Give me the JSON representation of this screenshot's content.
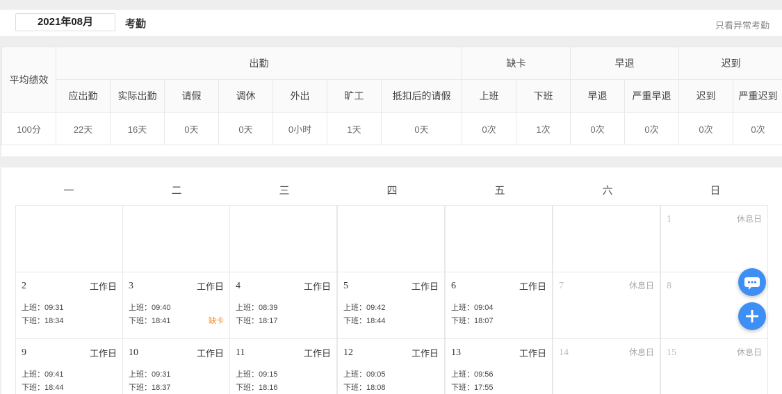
{
  "header": {
    "month": "2021年08月",
    "title": "考勤",
    "abnormal_link": "只看异常考勤"
  },
  "stats": {
    "avg_label": "平均绩效",
    "groups": {
      "attendance": "出勤",
      "missing": "缺卡",
      "early": "早退",
      "late": "迟到"
    },
    "columns": [
      "应出勤",
      "实际出勤",
      "请假",
      "调休",
      "外出",
      "旷工",
      "抵扣后的请假",
      "上班",
      "下班",
      "早退",
      "严重早退",
      "迟到",
      "严重迟到"
    ],
    "avg_value": "100分",
    "values": [
      "22天",
      "16天",
      "0天",
      "0天",
      "0小时",
      "1天",
      "0天",
      "0次",
      "1次",
      "0次",
      "0次",
      "0次",
      "0次"
    ]
  },
  "calendar": {
    "weekdays": [
      "一",
      "二",
      "三",
      "四",
      "五",
      "六",
      "日"
    ],
    "days": [
      {
        "num": "1",
        "type": "休息日",
        "rest": true
      },
      {
        "num": "2",
        "type": "工作日",
        "in": "上班：09:31",
        "out": "下班：18:34"
      },
      {
        "num": "3",
        "type": "工作日",
        "in": "上班：09:40",
        "out": "下班：18:41",
        "flag": "缺卡"
      },
      {
        "num": "4",
        "type": "工作日",
        "in": "上班：08:39",
        "out": "下班：18:17"
      },
      {
        "num": "5",
        "type": "工作日",
        "in": "上班：09:42",
        "out": "下班：18:44"
      },
      {
        "num": "6",
        "type": "工作日",
        "in": "上班：09:04",
        "out": "下班：18:07"
      },
      {
        "num": "7",
        "type": "休息日",
        "rest": true
      },
      {
        "num": "8",
        "type": "",
        "rest": true
      },
      {
        "num": "9",
        "type": "工作日",
        "in": "上班：09:41",
        "out": "下班：18:44"
      },
      {
        "num": "10",
        "type": "工作日",
        "in": "上班：09:31",
        "out": "下班：18:37"
      },
      {
        "num": "11",
        "type": "工作日",
        "in": "上班：09:15",
        "out": "下班：18:16"
      },
      {
        "num": "12",
        "type": "工作日",
        "in": "上班：09:05",
        "out": "下班：18:08"
      },
      {
        "num": "13",
        "type": "工作日",
        "in": "上班：09:56",
        "out": "下班：17:55"
      },
      {
        "num": "14",
        "type": "休息日",
        "rest": true
      },
      {
        "num": "15",
        "type": "休息日",
        "rest": true
      }
    ]
  },
  "colors": {
    "accent": "#3d8ef5",
    "warning": "#f08a24"
  },
  "fabs": {
    "chat_icon": "chat-bubble-icon",
    "add_icon": "plus-icon"
  }
}
